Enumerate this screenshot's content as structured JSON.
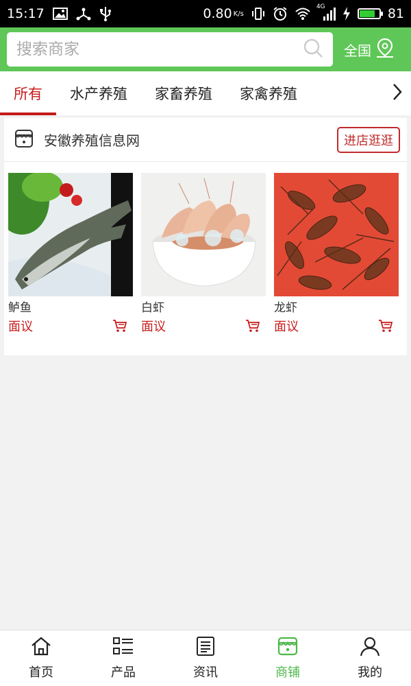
{
  "status_bar": {
    "time": "15:17",
    "speed": "0.80",
    "speed_unit": "K/s",
    "network": "4G",
    "battery_level": 81,
    "battery_text": "81"
  },
  "search": {
    "placeholder": "搜索商家",
    "region_label": "全国"
  },
  "tabs": [
    {
      "label": "所有",
      "active": true
    },
    {
      "label": "水产养殖",
      "active": false
    },
    {
      "label": "家畜养殖",
      "active": false
    },
    {
      "label": "家禽养殖",
      "active": false
    }
  ],
  "shop": {
    "name": "安徽养殖信息网",
    "visit_label": "进店逛逛",
    "products": [
      {
        "name": "鲈鱼",
        "price": "面议",
        "image": "sea-bass-photo"
      },
      {
        "name": "白虾",
        "price": "面议",
        "image": "white-shrimp-photo"
      },
      {
        "name": "龙虾",
        "price": "面议",
        "image": "crayfish-photo"
      }
    ]
  },
  "bottom_nav": [
    {
      "label": "首页",
      "icon": "home-icon",
      "active": false
    },
    {
      "label": "产品",
      "icon": "list-icon",
      "active": false
    },
    {
      "label": "资讯",
      "icon": "news-icon",
      "active": false
    },
    {
      "label": "商铺",
      "icon": "store-icon",
      "active": true
    },
    {
      "label": "我的",
      "icon": "user-icon",
      "active": false
    }
  ],
  "colors": {
    "brand_green": "#5fc758",
    "accent_red": "#c71b1b",
    "active_nav": "#4cb84a"
  }
}
